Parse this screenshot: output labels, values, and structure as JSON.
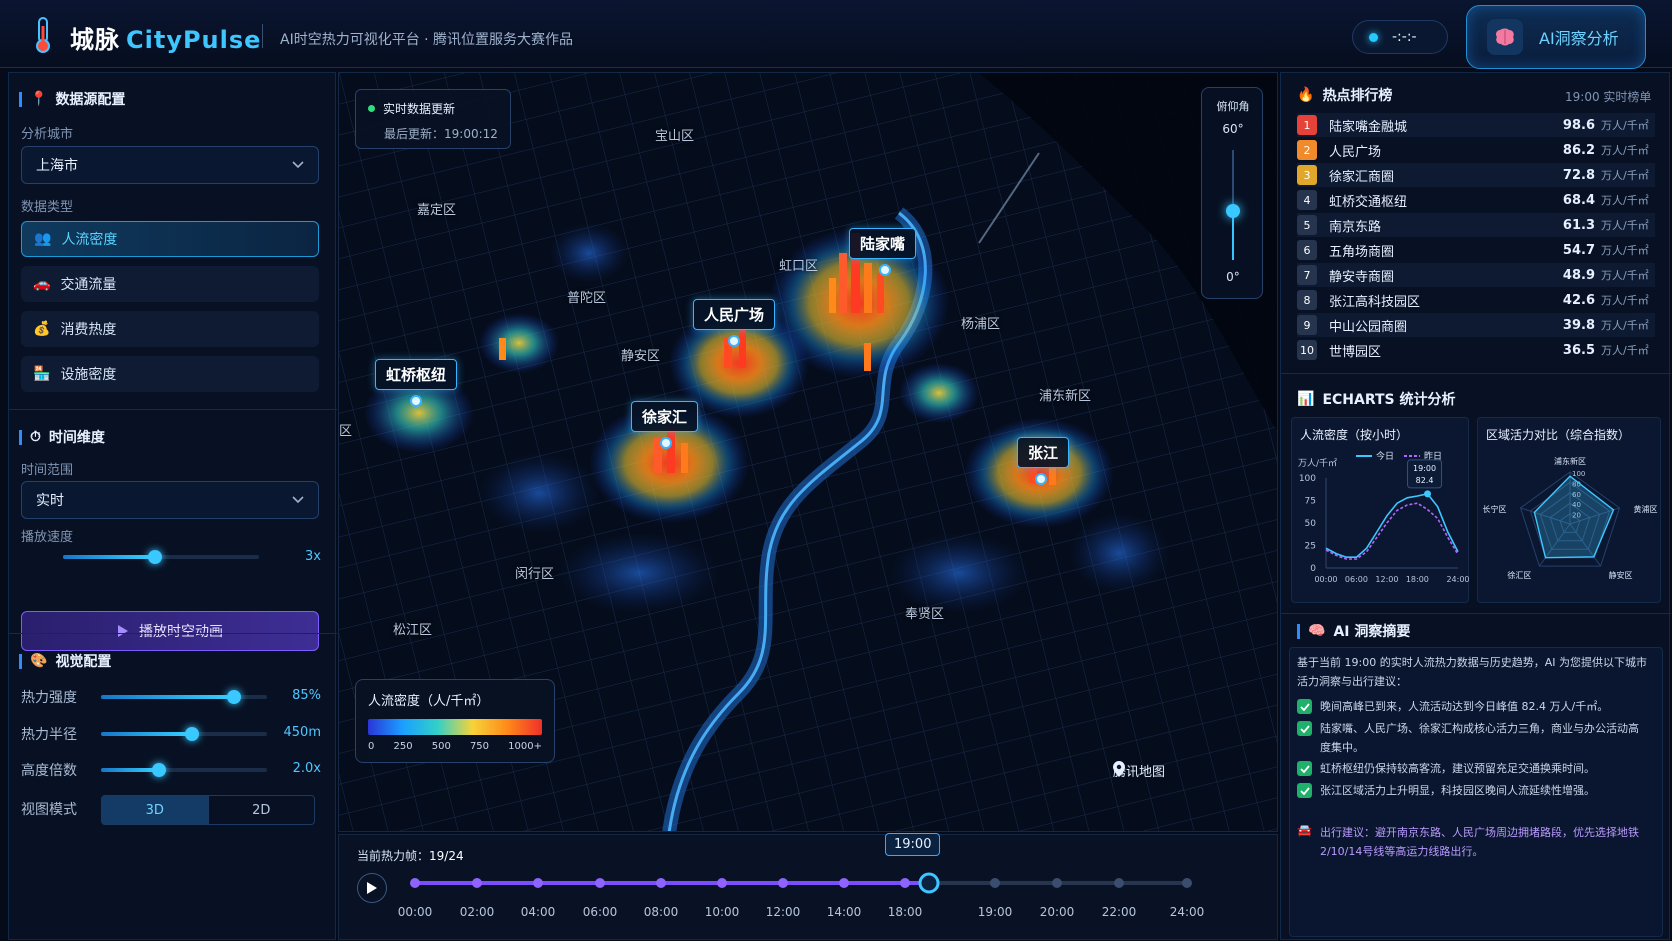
{
  "header": {
    "brand_cn": "城脉",
    "brand_en": "CityPulse",
    "subtitle": "AI时空热力可视化平台 · 腾讯位置服务大赛作品",
    "clock": "-:-:-",
    "ai_button": "AI洞察分析"
  },
  "left": {
    "datasource_title": "数据源配置",
    "city_label": "分析城市",
    "city_value": "上海市",
    "dtype_label": "数据类型",
    "dtypes": [
      "人流密度",
      "交通流量",
      "消费热度",
      "设施密度"
    ],
    "time_title": "时间维度",
    "range_label": "时间范围",
    "range_value": "实时",
    "speed_label": "播放速度",
    "speed_value": "3x",
    "speed_level": 0.47,
    "play_label": "播放时空动画",
    "visual_title": "视觉配置",
    "heat_label": "热力强度",
    "heat_value": "85%",
    "heat_level": 0.8,
    "radius_label": "热力半径",
    "radius_value": "450m",
    "radius_level": 0.55,
    "height_label": "高度倍数",
    "height_value": "2.0x",
    "height_level": 0.35,
    "view_label": "视图模式",
    "view_3d": "3D",
    "view_2d": "2D"
  },
  "map": {
    "live_title": "实时数据更新",
    "live_time": "最后更新：19:00:12",
    "pitch_title": "俯仰角",
    "pitch_max": "60°",
    "pitch_min": "0°",
    "pitch_level": 0.45,
    "districts": [
      "宝山区",
      "嘉定区",
      "虹口区",
      "普陀区",
      "静安区",
      "杨浦区",
      "浦东新区",
      "闵行区",
      "松江区",
      "奉贤区",
      "区"
    ],
    "hotspots": [
      "陆家嘴",
      "人民广场",
      "虹桥枢纽",
      "徐家汇",
      "张江"
    ],
    "legend_title": "人流密度（人/千㎡）",
    "legend_ticks": [
      "0",
      "250",
      "500",
      "750",
      "1000+"
    ],
    "attribution": "腾讯地图",
    "colors": {
      "accent": "#3ec6ff",
      "hot": "#f0302a",
      "warm": "#ff8a1a"
    }
  },
  "timeline": {
    "frame_label": "当前热力帧：",
    "frame_value": "19/24",
    "current": "19:00",
    "ticks": [
      "00:00",
      "02:00",
      "04:00",
      "06:00",
      "08:00",
      "10:00",
      "12:00",
      "14:00",
      "18:00",
      "19:00",
      "20:00",
      "22:00",
      "24:00"
    ]
  },
  "right": {
    "rank_title": "热点排行榜",
    "rank_meta": "19:00 实时榜单",
    "rank_unit": "万人/千㎡",
    "ranks": [
      {
        "no": "1",
        "name": "陆家嘴金融城",
        "val": "98.6"
      },
      {
        "no": "2",
        "name": "人民广场",
        "val": "86.2"
      },
      {
        "no": "3",
        "name": "徐家汇商圈",
        "val": "72.8"
      },
      {
        "no": "4",
        "name": "虹桥交通枢纽",
        "val": "68.4"
      },
      {
        "no": "5",
        "name": "南京东路",
        "val": "61.3"
      },
      {
        "no": "6",
        "name": "五角场商圈",
        "val": "54.7"
      },
      {
        "no": "7",
        "name": "静安寺商圈",
        "val": "48.9"
      },
      {
        "no": "8",
        "name": "张江高科技园区",
        "val": "42.6"
      },
      {
        "no": "9",
        "name": "中山公园商圈",
        "val": "39.8"
      },
      {
        "no": "10",
        "name": "世博园区",
        "val": "36.5"
      }
    ],
    "stats_title": "ECHARTS 统计分析",
    "line_title": "人流密度（按小时）",
    "line_unit": "万人/千㎡",
    "line_legend_today": "今日",
    "line_legend_yesterday": "昨日",
    "line_tip_time": "19:00",
    "line_tip_val": "82.4",
    "radar_title": "区域活力对比（综合指数）",
    "insight_title": "AI 洞察摘要",
    "insight_intro": "基于当前 19:00 的实时人流热力数据与历史趋势，AI 为您提供以下城市活力洞察与出行建议：",
    "insights": [
      "晚间高峰已到来，人流活动达到今日峰值 82.4 万人/千㎡。",
      "陆家嘴、人民广场、徐家汇构成核心活力三角，商业与办公活动高度集中。",
      "虹桥枢纽仍保持较高客流，建议预留充足交通换乘时间。",
      "张江区域活力上升明显，科技园区晚间人流延续性增强。"
    ],
    "advice": "出行建议：避开南京东路、人民广场周边拥堵路段，优先选择地铁2/10/14号线等高运力线路出行。"
  },
  "chart_data": [
    {
      "type": "line",
      "title": "人流密度（按小时）",
      "ylabel": "万人/千㎡",
      "x": [
        "00:00",
        "02:00",
        "04:00",
        "06:00",
        "08:00",
        "10:00",
        "12:00",
        "14:00",
        "16:00",
        "18:00",
        "19:00",
        "20:00",
        "22:00",
        "24:00"
      ],
      "x_ticks": [
        "00:00",
        "06:00",
        "12:00",
        "18:00",
        "24:00"
      ],
      "ylim": [
        0,
        100
      ],
      "y_ticks": [
        0,
        25,
        50,
        75,
        100
      ],
      "series": [
        {
          "name": "今日",
          "values": [
            22,
            16,
            12,
            12,
            22,
            40,
            58,
            72,
            78,
            80,
            82.4,
            68,
            40,
            18
          ]
        },
        {
          "name": "昨日",
          "values": [
            20,
            14,
            10,
            10,
            18,
            34,
            50,
            64,
            70,
            72,
            65,
            55,
            34,
            15
          ]
        }
      ],
      "annotation": {
        "x": "19:00",
        "value": 82.4
      }
    },
    {
      "type": "radar",
      "title": "区域活力对比（综合指数）",
      "axes": [
        "浦东新区",
        "黄浦区",
        "静安区",
        "徐汇区",
        "长宁区"
      ],
      "rings": [
        20,
        40,
        60,
        80,
        100
      ],
      "ring_labels": [
        "100",
        "80",
        "60",
        "40",
        "20"
      ],
      "series": [
        {
          "values": [
            92,
            88,
            78,
            80,
            72
          ]
        }
      ]
    }
  ]
}
